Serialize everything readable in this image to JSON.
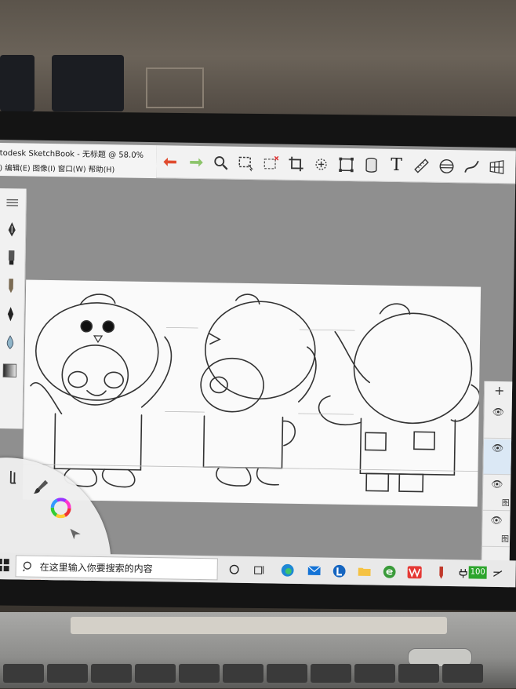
{
  "app": {
    "title": "todesk SketchBook - 无标题 @ 58.0%",
    "menu": ") 编辑(E)  图像(I)  窗口(W)  帮助(H)"
  },
  "toolbar": {
    "icons": [
      "undo-arrow-icon",
      "redo-arrow-icon",
      "zoom-icon",
      "select-icon",
      "crop-select-icon",
      "crop-icon",
      "lasso-icon",
      "transform-icon",
      "cylinder-icon",
      "text-icon",
      "ruler-icon",
      "symmetry-icon",
      "curve-icon",
      "perspective-icon"
    ],
    "text_tool": "T"
  },
  "taskbar": {
    "search_placeholder": "在这里输入你要搜索的内容",
    "battery_label": "100"
  },
  "layers": {
    "add_label": "+",
    "items": [
      "",
      "",
      "",
      "图",
      "图"
    ]
  },
  "colors": {
    "undo": "#e04b2e",
    "redo": "#8cc46a",
    "canvas": "#fafafa",
    "accent_taskbar_green": "#2ca52c"
  }
}
